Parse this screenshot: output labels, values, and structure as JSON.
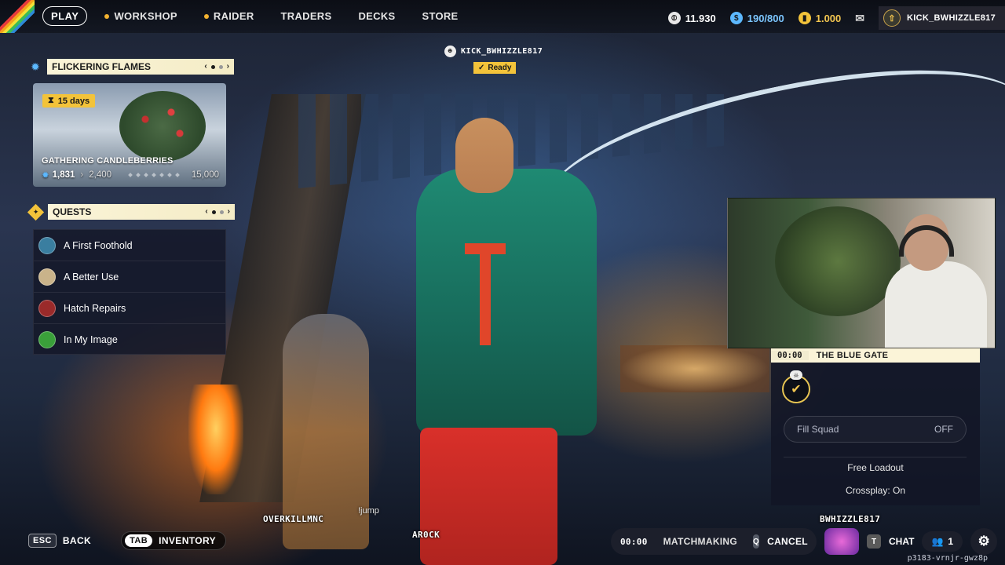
{
  "nav": {
    "play": "PLAY",
    "items": [
      "WORKSHOP",
      "RAIDER",
      "TRADERS",
      "DECKS",
      "STORE"
    ]
  },
  "currency": {
    "coins": "11.930",
    "tokens": "190/800",
    "credits": "1.000",
    "username": "KICK_BWHIZZLE817"
  },
  "event": {
    "title": "FLICKERING FLAMES",
    "days": "15  days",
    "name": "GATHERING CANDLEBERRIES",
    "current": "1,831",
    "next": "2,400",
    "max": "15,000"
  },
  "quests": {
    "title": "QUESTS",
    "items": [
      {
        "label": "A First Foothold",
        "color": "#3a7ea0"
      },
      {
        "label": "A Better Use",
        "color": "#c9b38a"
      },
      {
        "label": "Hatch Repairs",
        "color": "#9a2a2a"
      },
      {
        "label": "In My Image",
        "color": "#3aa03a"
      }
    ]
  },
  "lobby": {
    "player": "KICK_BWHIZZLE817",
    "ready": "Ready"
  },
  "party": {
    "time": "00:00",
    "map": "THE BLUE GATE",
    "fill_squad": "Fill Squad",
    "fill_squad_value": "OFF",
    "loadout": "Free Loadout",
    "crossplay": "Crossplay: On"
  },
  "tags": {
    "overkill": "OVERKILLMNC",
    "jump": "!jump",
    "arock": "AR0CK",
    "bwhizzle": "BWHIZZLE817"
  },
  "bottom": {
    "esc_key": "ESC",
    "back": "BACK",
    "tab_key": "TAB",
    "inventory": "INVENTORY",
    "mm_time": "00:00",
    "matchmaking": "MATCHMAKING",
    "cancel_key": "Q",
    "cancel": "CANCEL",
    "chat_key": "T",
    "chat": "CHAT",
    "friends_count": "1",
    "session_id": "p3183-vrnjr-gwz8p"
  },
  "colors": {
    "accent_yellow": "#f3c33a",
    "panel_cream": "#fbf4d8",
    "blue_currency": "#5cb8ff"
  }
}
